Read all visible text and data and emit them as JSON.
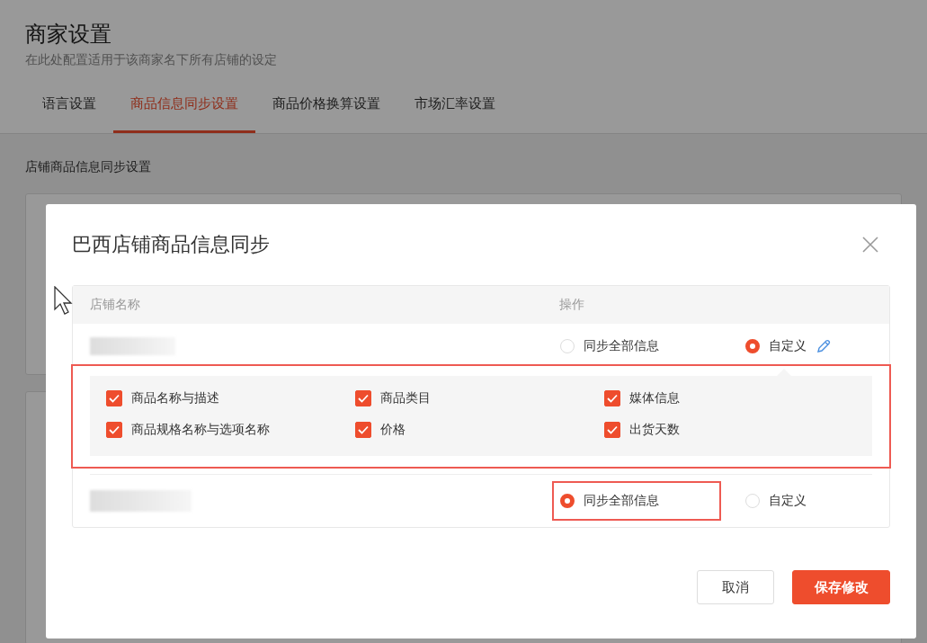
{
  "page": {
    "title": "商家设置",
    "subtitle": "在此处配置适用于该商家名下所有店铺的设定",
    "tabs": [
      {
        "label": "语言设置",
        "selected": false
      },
      {
        "label": "商品信息同步设置",
        "selected": true
      },
      {
        "label": "商品价格换算设置",
        "selected": false
      },
      {
        "label": "市场汇率设置",
        "selected": false
      }
    ],
    "section_title": "店铺商品信息同步设置"
  },
  "dialog": {
    "title": "巴西店铺商品信息同步",
    "table": {
      "columns": [
        "店铺名称",
        "操作"
      ],
      "rows": [
        {
          "highlighted": true,
          "options": [
            {
              "label": "同步全部信息",
              "kind": "all",
              "selected": false,
              "highlighted": false
            },
            {
              "label": "自定义",
              "kind": "custom",
              "selected": true,
              "highlighted": false
            }
          ],
          "fields": [
            {
              "label": "商品名称与描述",
              "checked": true
            },
            {
              "label": "商品类目",
              "checked": true
            },
            {
              "label": "媒体信息",
              "checked": true
            },
            {
              "label": "商品规格名称与选项名称",
              "checked": true
            },
            {
              "label": "价格",
              "checked": true
            },
            {
              "label": "出货天数",
              "checked": true
            }
          ]
        },
        {
          "options": [
            {
              "label": "同步全部信息",
              "kind": "all",
              "selected": true,
              "highlighted": true
            },
            {
              "label": "自定义",
              "kind": "custom",
              "selected": false,
              "highlighted": false
            }
          ]
        }
      ]
    },
    "buttons": [
      {
        "label": "取消",
        "kind": "secondary"
      },
      {
        "label": "保存修改",
        "kind": "primary"
      }
    ]
  }
}
